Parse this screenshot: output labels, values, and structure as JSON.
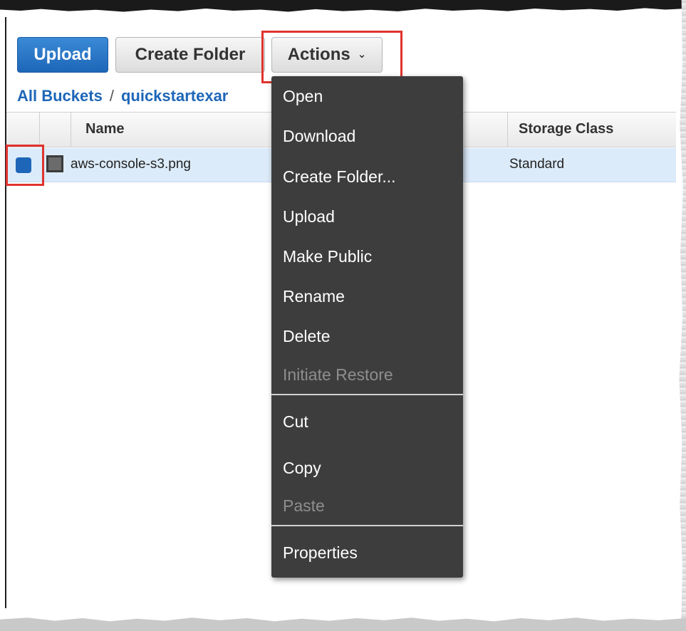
{
  "toolbar": {
    "upload_label": "Upload",
    "create_folder_label": "Create Folder",
    "actions_label": "Actions"
  },
  "breadcrumb": {
    "root": "All Buckets",
    "separator": "/",
    "bucket": "quickstartexar"
  },
  "table": {
    "columns": [
      "Name",
      "Storage Class"
    ],
    "rows": [
      {
        "name": "aws-console-s3.png",
        "storage_class": "Standard",
        "selected": true
      }
    ]
  },
  "actions_menu": {
    "items": [
      {
        "label": "Open",
        "enabled": true
      },
      {
        "label": "Download",
        "enabled": true
      },
      {
        "label": "Create Folder...",
        "enabled": true
      },
      {
        "label": "Upload",
        "enabled": true
      },
      {
        "label": "Make Public",
        "enabled": true
      },
      {
        "label": "Rename",
        "enabled": true
      },
      {
        "label": "Delete",
        "enabled": true
      },
      {
        "label": "Initiate Restore",
        "enabled": false
      },
      {
        "label": "Cut",
        "enabled": true
      },
      {
        "label": "Copy",
        "enabled": true
      },
      {
        "label": "Paste",
        "enabled": false
      },
      {
        "label": "Properties",
        "enabled": true
      }
    ]
  },
  "colors": {
    "primary_button": "#1e66b8",
    "link": "#1e66b8",
    "selected_row": "#dcebfa",
    "menu_background": "#3d3d3d",
    "menu_disabled_text": "#8e8e8e",
    "highlight_box": "#e0332e"
  },
  "icons": {
    "chevron": "chevron-down-icon",
    "file": "file-icon"
  }
}
